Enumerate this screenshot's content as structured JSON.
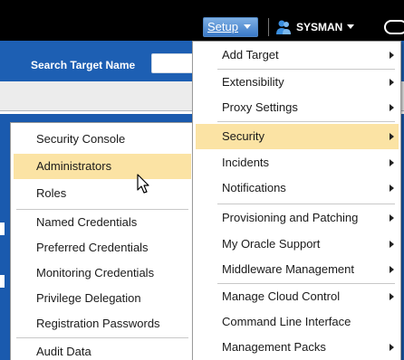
{
  "header": {
    "setup_label": "Setup",
    "user_label": "SYSMAN"
  },
  "search": {
    "label": "Search Target Name",
    "value": ""
  },
  "setup_menu": {
    "items": [
      {
        "label": "Add Target",
        "has_submenu": true
      },
      {
        "label": "Extensibility",
        "has_submenu": true
      },
      {
        "label": "Proxy Settings",
        "has_submenu": true
      },
      {
        "label": "Security",
        "has_submenu": true,
        "highlighted": true
      },
      {
        "label": "Incidents",
        "has_submenu": true
      },
      {
        "label": "Notifications",
        "has_submenu": true
      },
      {
        "label": "Provisioning and Patching",
        "has_submenu": true
      },
      {
        "label": "My Oracle Support",
        "has_submenu": true
      },
      {
        "label": "Middleware Management",
        "has_submenu": true
      },
      {
        "label": "Manage Cloud Control",
        "has_submenu": true
      },
      {
        "label": "Command Line Interface",
        "has_submenu": false
      },
      {
        "label": "Management Packs",
        "has_submenu": true
      }
    ]
  },
  "security_submenu": {
    "items": [
      {
        "label": "Security Console"
      },
      {
        "label": "Administrators",
        "highlighted": true
      },
      {
        "label": "Roles"
      },
      {
        "label": "Named Credentials"
      },
      {
        "label": "Preferred Credentials"
      },
      {
        "label": "Monitoring Credentials"
      },
      {
        "label": "Privilege Delegation"
      },
      {
        "label": "Registration Passwords"
      },
      {
        "label": "Audit Data"
      }
    ]
  },
  "colors": {
    "header_bg": "#000000",
    "search_band": "#1d5fb3",
    "menu_highlight": "#fbe3a4",
    "setup_button": "#3a79c7"
  }
}
